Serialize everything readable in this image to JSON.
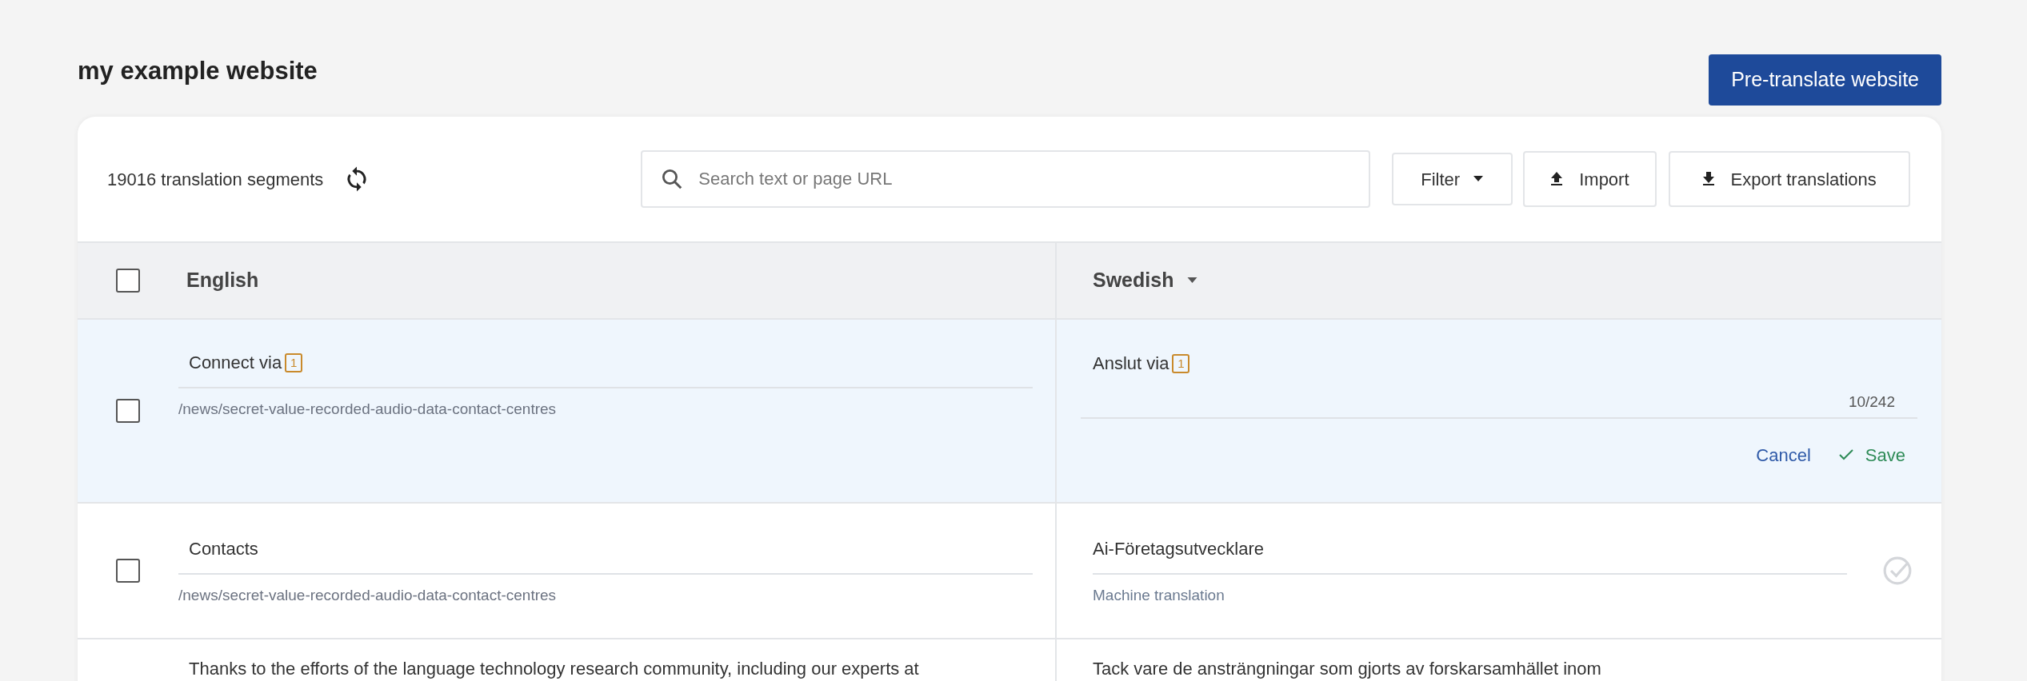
{
  "page": {
    "title": "my example website",
    "primary_button": "Pre-translate website"
  },
  "toolbar": {
    "segment_count": "19016 translation segments",
    "search": {
      "placeholder": "Search text or page URL"
    },
    "filter": "Filter",
    "import": "Import",
    "export": "Export translations"
  },
  "table": {
    "select_all": {
      "checked": false
    },
    "source_language": "English",
    "target_language": "Swedish",
    "rows": [
      {
        "kind": "editing",
        "checked": false,
        "source": "Connect via",
        "source_badge": "1",
        "url": "/news/secret-value-recorded-audio-data-contact-centres",
        "target": "Anslut via",
        "target_badge": "1",
        "char_count": "10/242",
        "cancel": "Cancel",
        "save": "Save"
      },
      {
        "kind": "view",
        "checked": false,
        "source": "Contacts",
        "url": "/news/secret-value-recorded-audio-data-contact-centres",
        "target": "Ai-Företagsutvecklare",
        "note": "Machine translation",
        "approved": false
      },
      {
        "kind": "partial",
        "source": "Thanks to the efforts of the language technology research community, including our experts at",
        "target": "Tack vare de ansträngningar som gjorts av forskarsamhället inom"
      }
    ]
  }
}
